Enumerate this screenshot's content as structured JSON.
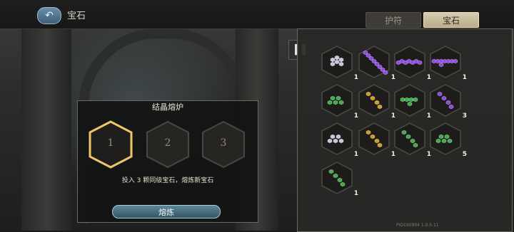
{
  "header": {
    "title": "宝石",
    "back_icon": "back-arrow-icon"
  },
  "tabs": [
    {
      "label": "护符",
      "active": false
    },
    {
      "label": "宝石",
      "active": true
    }
  ],
  "sort_button": {
    "icon": "sort-bars-icon"
  },
  "inventory": [
    {
      "gem": "white",
      "pattern": "cluster",
      "count": "1"
    },
    {
      "gem": "purple",
      "pattern": "diag-long",
      "count": "1"
    },
    {
      "gem": "purple",
      "pattern": "hline-long",
      "count": "1"
    },
    {
      "gem": "purple",
      "pattern": "hline-long2",
      "count": "1"
    },
    {
      "gem": "green",
      "pattern": "triangle",
      "count": "1"
    },
    {
      "gem": "yellow",
      "pattern": "diag",
      "count": "1"
    },
    {
      "gem": "green",
      "pattern": "hline",
      "count": "1"
    },
    {
      "gem": "purple",
      "pattern": "diag",
      "count": "3"
    },
    {
      "gem": "white",
      "pattern": "triangle",
      "count": "1"
    },
    {
      "gem": "yellow",
      "pattern": "diag",
      "count": "1"
    },
    {
      "gem": "green",
      "pattern": "diag",
      "count": "1"
    },
    {
      "gem": "green",
      "pattern": "triangle",
      "count": "5"
    },
    {
      "gem": "green",
      "pattern": "diag",
      "count": "1"
    }
  ],
  "gem_colors": {
    "white": "#c9c6d8",
    "purple": "#8d4de0",
    "green": "#3fae4a",
    "yellow": "#d39c1c"
  },
  "version": "PID190994  1.0.5.11",
  "forge": {
    "title": "结晶熔炉",
    "slots": [
      "1",
      "2",
      "3"
    ],
    "instruction": "投入 3 颗同级宝石，熔炼新宝石",
    "button_label": "熔炼"
  }
}
